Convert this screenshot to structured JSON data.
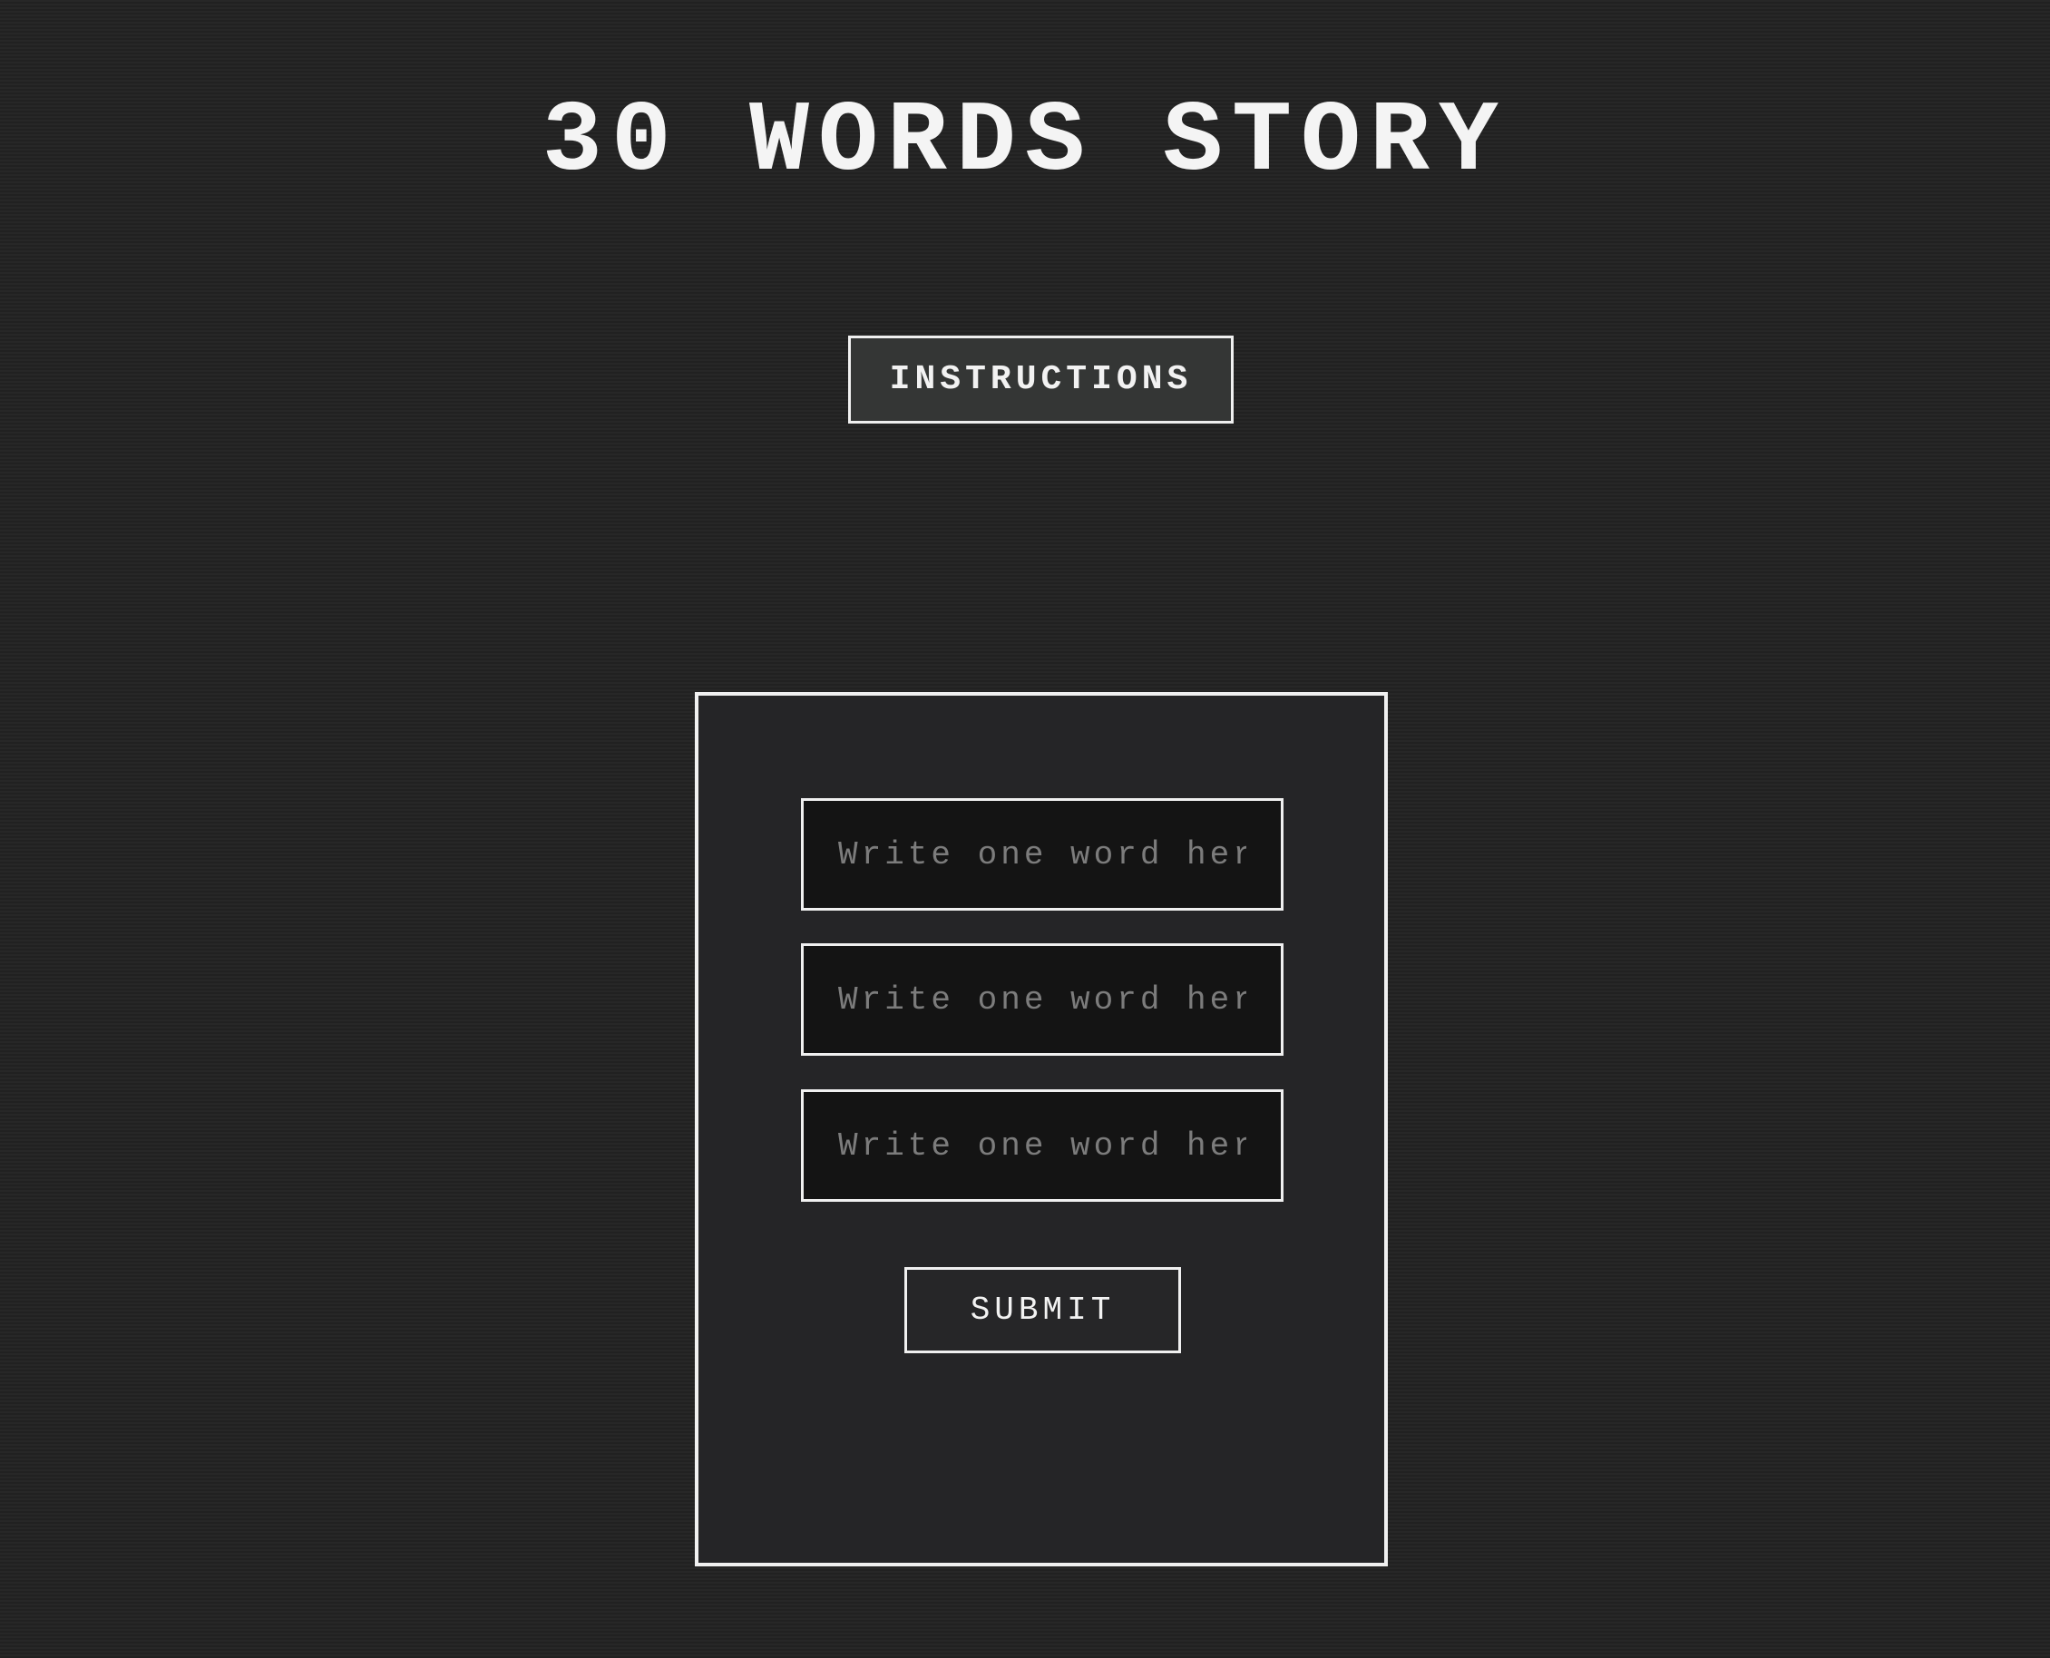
{
  "header": {
    "title": "30 WORDS STORY"
  },
  "instructions_button": {
    "label": "INSTRUCTIONS"
  },
  "story_form": {
    "inputs": [
      {
        "value": "",
        "placeholder": "Write one word here"
      },
      {
        "value": "",
        "placeholder": "Write one word here"
      },
      {
        "value": "",
        "placeholder": "Write one word here"
      }
    ],
    "submit_label": "SUBMIT"
  },
  "colors": {
    "background": "#232323",
    "border": "#f0f0f0",
    "input_background": "#141414",
    "placeholder": "#7c7c7c",
    "instructions_background": "#343635"
  }
}
